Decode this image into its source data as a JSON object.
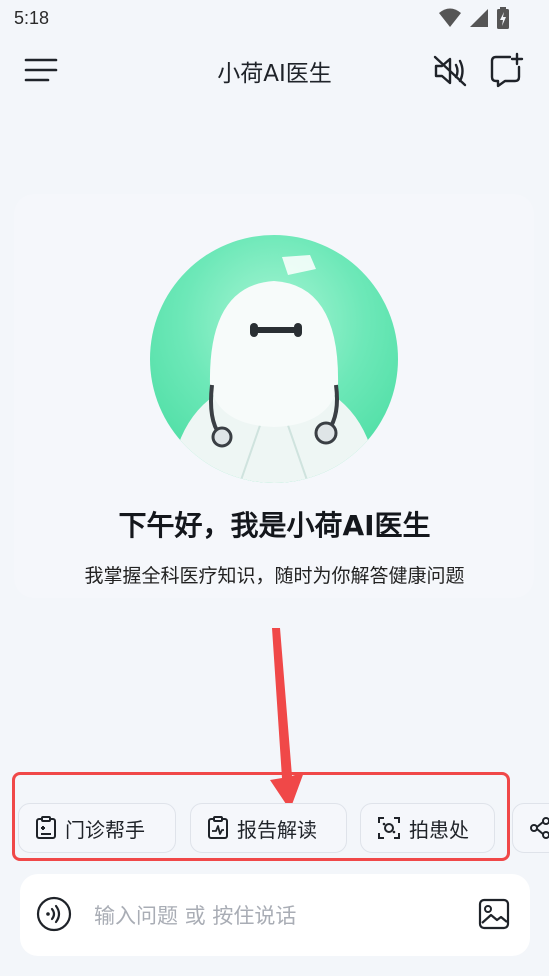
{
  "status_bar": {
    "time": "5:18"
  },
  "header": {
    "title": "小荷AI医生"
  },
  "hero": {
    "greeting": "下午好，我是小荷AI医生",
    "subtitle": "我掌握全科医疗知识，随时为你解答健康问题"
  },
  "quick_actions": [
    {
      "label": "门诊帮手",
      "icon": "clipboard-icon"
    },
    {
      "label": "报告解读",
      "icon": "report-icon"
    },
    {
      "label": "拍患处",
      "icon": "camera-scan-icon"
    },
    {
      "label": "",
      "icon": "share-icon"
    }
  ],
  "input": {
    "placeholder": "输入问题 或 按住说话"
  },
  "colors": {
    "accent_green": "#4fe0a6",
    "annotation_red": "#f04848"
  }
}
